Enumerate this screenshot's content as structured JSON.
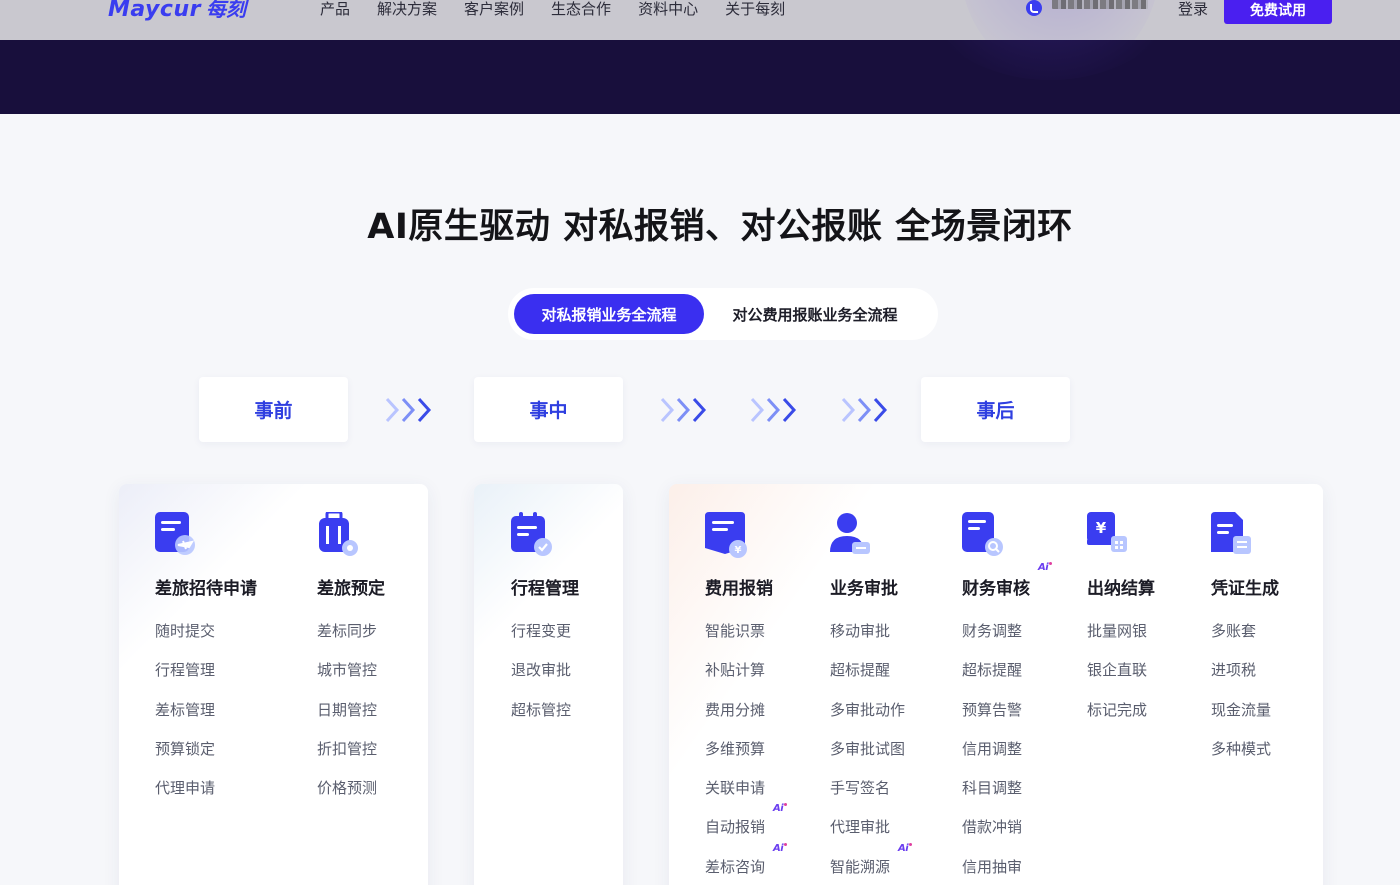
{
  "nav": {
    "logo_en": "Maycur",
    "logo_cn": "每刻",
    "menu": [
      "产品",
      "解决方案",
      "客户案例",
      "生态合作",
      "资料中心",
      "关于每刻"
    ],
    "login": "登录",
    "trial": "免费试用"
  },
  "headline": "AI原生驱动 对私报销、对公报账 全场景闭环",
  "tabs": [
    {
      "label": "对私报销业务全流程",
      "active": true
    },
    {
      "label": "对公费用报账业务全流程",
      "active": false
    }
  ],
  "stages": [
    "事前",
    "事中",
    "事后"
  ],
  "badge_text": "Ai",
  "colors": {
    "brand": "#3a2ff0",
    "stage_text": "#2f3fe0",
    "dark_band": "#180f3c"
  },
  "cards": [
    {
      "columns": [
        {
          "icon": "travel-request-icon",
          "title": "差旅招待申请",
          "items": [
            "随时提交",
            "行程管理",
            "差标管理",
            "预算锁定",
            "代理申请"
          ],
          "ai": []
        },
        {
          "icon": "travel-booking-icon",
          "title": "差旅预定",
          "items": [
            "差标同步",
            "城市管控",
            "日期管控",
            "折扣管控",
            "价格预测"
          ],
          "ai": []
        }
      ]
    },
    {
      "columns": [
        {
          "icon": "itinerary-icon",
          "title": "行程管理",
          "items": [
            "行程变更",
            "退改审批",
            "超标管控"
          ],
          "ai": []
        }
      ]
    },
    {
      "columns": [
        {
          "icon": "expense-claim-icon",
          "title": "费用报销",
          "items": [
            "智能识票",
            "补贴计算",
            "费用分摊",
            "多维预算",
            "关联申请",
            "自动报销",
            "差标咨询"
          ],
          "ai": [
            5,
            6
          ]
        },
        {
          "icon": "approval-icon",
          "title": "业务审批",
          "items": [
            "移动审批",
            "超标提醒",
            "多审批动作",
            "多审批试图",
            "手写签名",
            "代理审批",
            "智能溯源"
          ],
          "ai": [
            6
          ]
        },
        {
          "icon": "finance-audit-icon",
          "title": "财务审核",
          "items": [
            "财务调整",
            "超标提醒",
            "预算告警",
            "信用调整",
            "科目调整",
            "借款冲销",
            "信用抽审"
          ],
          "ai": [],
          "title_ai": true
        },
        {
          "icon": "settlement-icon",
          "title": "出纳结算",
          "items": [
            "批量网银",
            "银企直联",
            "标记完成"
          ],
          "ai": []
        },
        {
          "icon": "voucher-icon",
          "title": "凭证生成",
          "items": [
            "多账套",
            "进项税",
            "现金流量",
            "多种模式"
          ],
          "ai": []
        }
      ]
    }
  ]
}
